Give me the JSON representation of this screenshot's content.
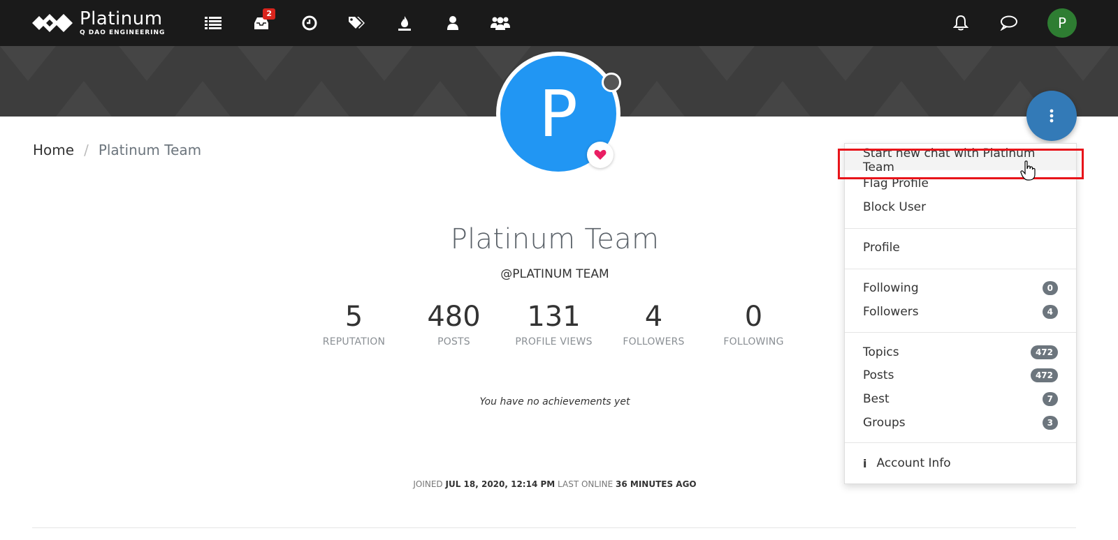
{
  "navbar": {
    "brand_name": "Platinum",
    "brand_sub": "Q DAO ENGINEERING",
    "inbox_badge": "2",
    "user_initial": "P"
  },
  "breadcrumb": {
    "home": "Home",
    "separator": "/",
    "current": "Platinum Team"
  },
  "profile": {
    "avatar_letter": "P",
    "fullname": "Platinum Team",
    "username": "@PLATINUM TEAM",
    "stats": [
      {
        "value": "5",
        "label": "REPUTATION"
      },
      {
        "value": "480",
        "label": "POSTS"
      },
      {
        "value": "131",
        "label": "PROFILE VIEWS"
      },
      {
        "value": "4",
        "label": "FOLLOWERS"
      },
      {
        "value": "0",
        "label": "FOLLOWING"
      }
    ],
    "achievements": "You have no achievements yet",
    "joined_label": "JOINED",
    "joined_value": "JUL 18, 2020, 12:14 PM",
    "last_online_label": "LAST ONLINE",
    "last_online_value": "36 MINUTES AGO"
  },
  "dropdown": {
    "start_chat": "Start new chat with Platinum Team",
    "flag": "Flag Profile",
    "block": "Block User",
    "profile": "Profile",
    "following": {
      "label": "Following",
      "count": "0"
    },
    "followers": {
      "label": "Followers",
      "count": "4"
    },
    "topics": {
      "label": "Topics",
      "count": "472"
    },
    "posts": {
      "label": "Posts",
      "count": "472"
    },
    "best": {
      "label": "Best",
      "count": "7"
    },
    "groups": {
      "label": "Groups",
      "count": "3"
    },
    "account_info": "Account Info"
  },
  "colors": {
    "navbar": "#1a1a1a",
    "avatar_blue": "#2196f3",
    "fab_blue": "#337ab7",
    "user_green": "#2e7d32",
    "highlight_red": "#e8141a",
    "badge_red": "#d9251d",
    "heart_pink": "#e91e63"
  }
}
